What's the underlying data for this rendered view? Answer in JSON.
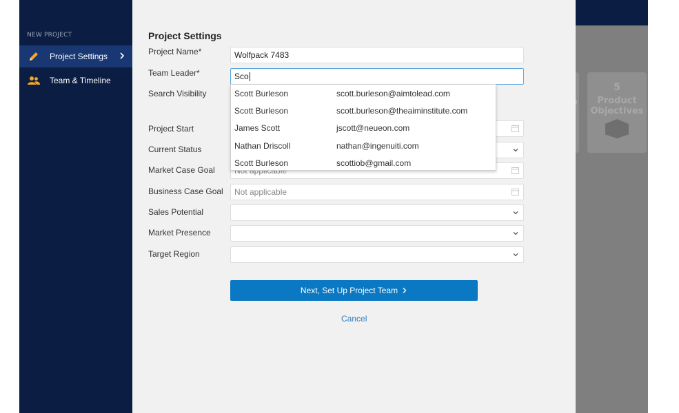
{
  "sidebar": {
    "heading": "NEW PROJECT",
    "items": [
      {
        "label": "Project Settings",
        "icon": "pencil-icon",
        "active": true
      },
      {
        "label": "Team & Timeline",
        "icon": "users-icon",
        "active": false
      }
    ]
  },
  "background": {
    "cards": [
      {
        "number": "5",
        "label_line1": "Product",
        "label_line2": "Objectives",
        "icon": "box-icon"
      }
    ],
    "partial_card_text": "e"
  },
  "main": {
    "title": "Project Settings",
    "fields": {
      "project_name": {
        "label": "Project Name*",
        "value": "Wolfpack 7483"
      },
      "team_leader": {
        "label": "Team Leader*",
        "value": "Sco"
      },
      "search_visibility": {
        "label": "Search Visibility"
      },
      "project_start": {
        "label": "Project Start"
      },
      "current_status": {
        "label": "Current Status"
      },
      "market_case_goal": {
        "label": "Market Case Goal",
        "placeholder": "Not applicable"
      },
      "business_case_goal": {
        "label": "Business Case Goal",
        "placeholder": "Not applicable"
      },
      "sales_potential": {
        "label": "Sales Potential"
      },
      "market_presence": {
        "label": "Market Presence"
      },
      "target_region": {
        "label": "Target Region"
      }
    },
    "suggestions": [
      {
        "name": "Scott Burleson",
        "email": "scott.burleson@aimtolead.com"
      },
      {
        "name": "Scott Burleson",
        "email": "scott.burleson@theaiminstitute.com"
      },
      {
        "name": "James Scott",
        "email": "jscott@neueon.com"
      },
      {
        "name": "Nathan Driscoll",
        "email": "nathan@ingenuiti.com"
      },
      {
        "name": "Scott Burleson",
        "email": "scottiob@gmail.com"
      }
    ],
    "next_button": "Next, Set Up Project Team",
    "cancel_link": "Cancel"
  },
  "colors": {
    "sidebar_bg": "#0b1d42",
    "sidebar_active": "#193873",
    "primary": "#0a78c2",
    "link": "#2b7dc0"
  }
}
